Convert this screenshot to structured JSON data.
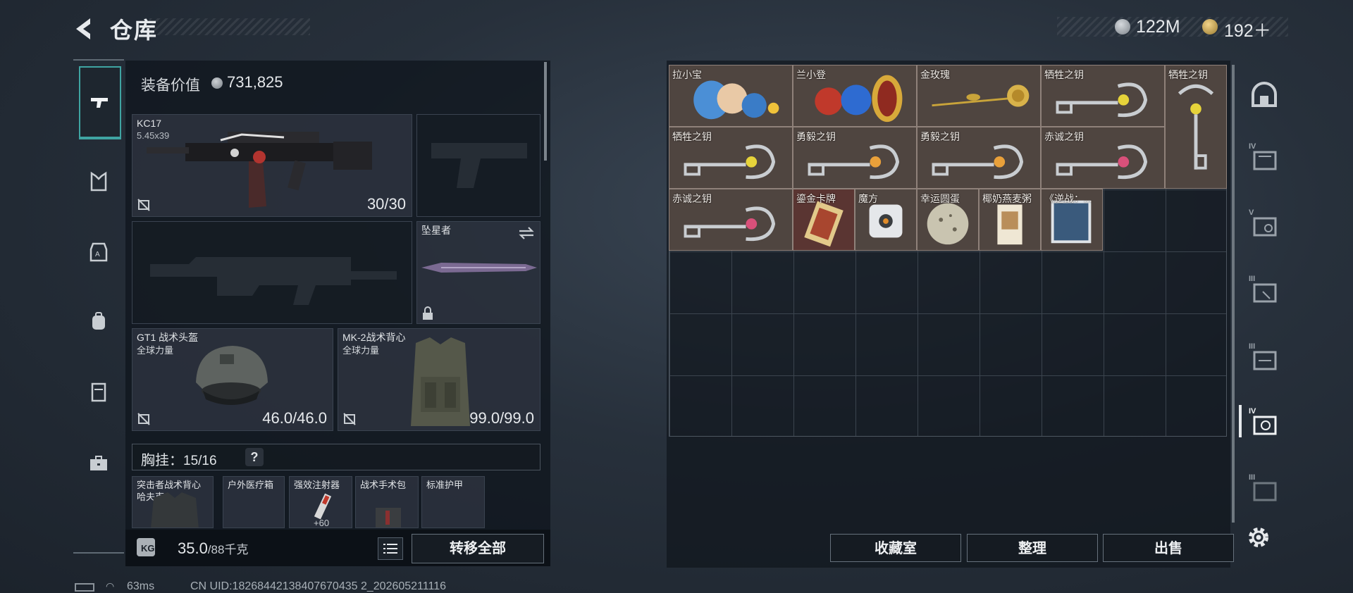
{
  "header": {
    "title": "仓库",
    "currencies": [
      {
        "value": "122M",
        "icon": "silver-coin-icon",
        "color": "#b9bec3"
      },
      {
        "value": "192＋",
        "icon": "gold-coin-icon",
        "color": "#d8b45c"
      }
    ],
    "mini_note": ""
  },
  "left_nav": {
    "items": [
      "weapon-icon",
      "vest-icon",
      "armor-icon",
      "backpack-icon",
      "case-icon",
      "toolbox-icon"
    ],
    "selected_color": "#3fa4a2"
  },
  "equipment": {
    "value_label": "装备价值",
    "value": "731,825",
    "primary": {
      "name": "KC17",
      "caliber": "5.45x39",
      "ammo": "30/30"
    },
    "melee": {
      "name": "坠星者"
    },
    "helmet": {
      "name": "GT1 战术头盔",
      "brand": "全球力量",
      "durability": "46.0/46.0"
    },
    "armor": {
      "name": "MK-2战术背心",
      "brand": "全球力量",
      "durability": "99.0/99.0"
    },
    "rig": {
      "label": "胸挂：",
      "count": "15/16",
      "help": "?"
    },
    "rig_items": [
      {
        "name": "突击者战术背心",
        "sub": "哈夫克"
      },
      {
        "name": "户外医疗箱"
      },
      {
        "name": "强效注射器",
        "sub": "+60"
      },
      {
        "name": "战术手术包"
      },
      {
        "name": "标准护甲"
      }
    ],
    "weight": "35.0",
    "weight_max": "/88千克",
    "transfer_all": "转移全部"
  },
  "status": {
    "ping": "63ms",
    "uid": "CN UID:18268442138407670435 2_202605211116"
  },
  "grid": {
    "items": [
      {
        "name": "拉小宝"
      },
      {
        "name": "兰小登"
      },
      {
        "name": "金玫瑰"
      },
      {
        "name": "牺牲之钥"
      },
      {
        "name": "牺牲之钥"
      },
      {
        "name": "牺牲之钥"
      },
      {
        "name": "勇毅之钥"
      },
      {
        "name": "勇毅之钥"
      },
      {
        "name": "赤诚之钥"
      },
      {
        "name": "赤诚之钥"
      },
      {
        "name": "鎏金卡牌"
      },
      {
        "name": "魔方"
      },
      {
        "name": "幸运圆蛋"
      },
      {
        "name": "椰奶燕麦粥"
      },
      {
        "name": "《逆战：..."
      }
    ],
    "buttons": {
      "collection": "收藏室",
      "sort": "整理",
      "sell": "出售"
    }
  },
  "right_nav": {
    "tabs": [
      "IV",
      "V",
      "III",
      "III",
      "IV",
      "III"
    ]
  }
}
